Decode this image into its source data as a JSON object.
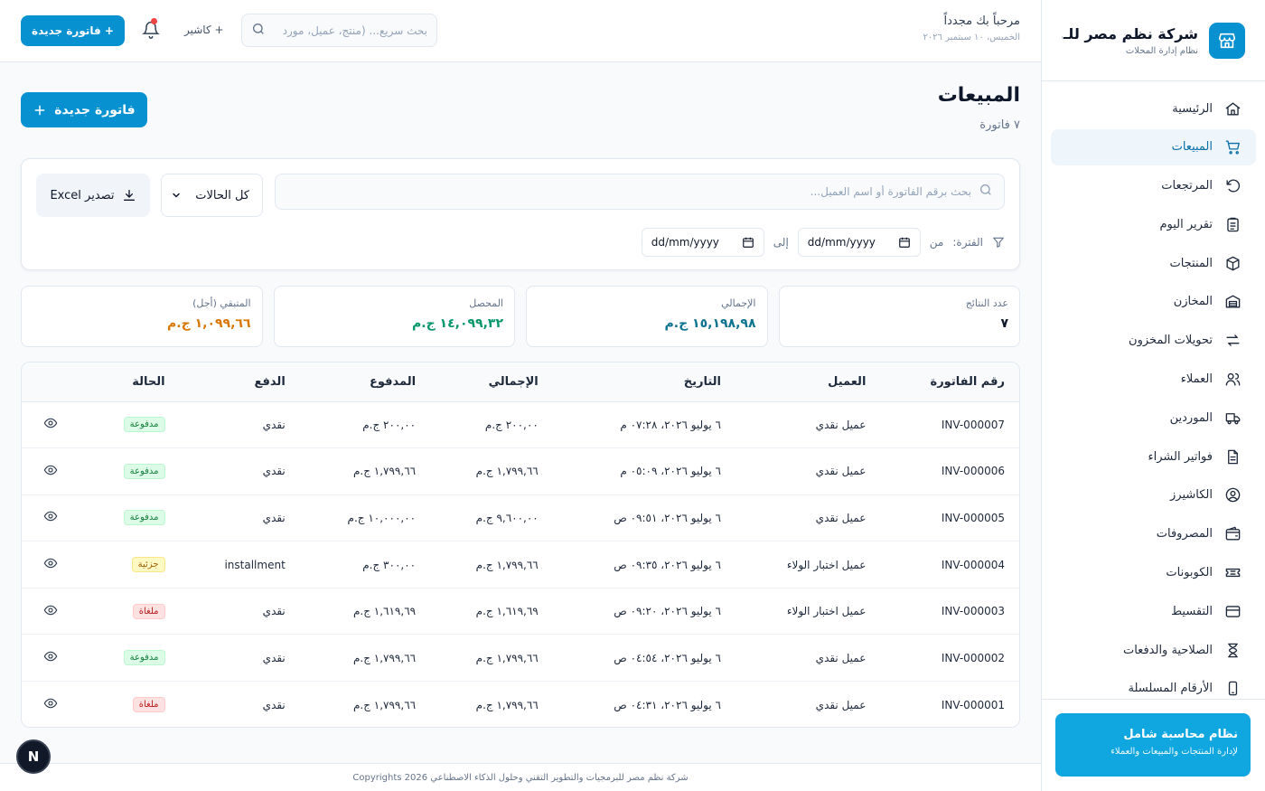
{
  "brand": {
    "name": "شركة نظم مصر للـ...",
    "subtitle": "نظام إدارة المحلات"
  },
  "sidebar": {
    "items": [
      {
        "label": "الرئيسية",
        "icon": "home-icon",
        "active": false
      },
      {
        "label": "المبيعات",
        "icon": "cart-icon",
        "active": true
      },
      {
        "label": "المرتجعات",
        "icon": "undo-icon",
        "active": false
      },
      {
        "label": "تقرير اليوم",
        "icon": "clipboard-icon",
        "active": false
      },
      {
        "label": "المنتجات",
        "icon": "box-icon",
        "active": false
      },
      {
        "label": "المخازن",
        "icon": "warehouse-icon",
        "active": false
      },
      {
        "label": "تحويلات المخزون",
        "icon": "transfer-icon",
        "active": false
      },
      {
        "label": "العملاء",
        "icon": "users-icon",
        "active": false
      },
      {
        "label": "الموردين",
        "icon": "truck-icon",
        "active": false
      },
      {
        "label": "فواتير الشراء",
        "icon": "file-icon",
        "active": false
      },
      {
        "label": "الكاشيرز",
        "icon": "user-circle-icon",
        "active": false
      },
      {
        "label": "المصروفات",
        "icon": "wallet-icon",
        "active": false
      },
      {
        "label": "الكوبونات",
        "icon": "ticket-icon",
        "active": false
      },
      {
        "label": "التقسيط",
        "icon": "credit-card-icon",
        "active": false
      },
      {
        "label": "الصلاحية والدفعات",
        "icon": "hourglass-icon",
        "active": false
      },
      {
        "label": "الأرقام المسلسلة",
        "icon": "phone-icon",
        "active": false
      }
    ],
    "promo": {
      "title": "نظام محاسبة شامل",
      "subtitle": "لإدارة المنتجات والمبيعات والعملاء"
    }
  },
  "header": {
    "welcome": "مرحباً بك مجدداً",
    "date": "الخميس، ١٠ سبتمبر ٢٠٢٦",
    "search_placeholder": "بحث سريع... (منتج، عميل، مورد",
    "cashier_label": "+ كاشير",
    "new_invoice_label": "+ فاتورة جديدة"
  },
  "page": {
    "title": "المبيعات",
    "subtitle": "٧ فاتورة",
    "new_invoice_label": "فاتورة جديدة"
  },
  "filters": {
    "search_placeholder": "بحث برقم الفاتورة أو اسم العميل...",
    "status_value": "كل الحالات",
    "export_label": "تصدير Excel",
    "period_label": "الفترة:",
    "from_label": "من",
    "to_label": "إلى",
    "from_value": "dd/mm/yyyy",
    "to_value": "dd/mm/yyyy"
  },
  "stats": [
    {
      "label": "عدد النتائج",
      "value": "٧",
      "color": "#0f172a"
    },
    {
      "label": "الإجمالي",
      "value": "١٥,١٩٨,٩٨ ج.م",
      "color": "#0e7490"
    },
    {
      "label": "المحصل",
      "value": "١٤,٠٩٩,٣٢ ج.م",
      "color": "#059669"
    },
    {
      "label": "المتبقي (أجل)",
      "value": "١,٠٩٩,٦٦ ج.م",
      "color": "#d97706"
    }
  ],
  "table": {
    "columns": [
      "رقم الفاتورة",
      "العميل",
      "التاريخ",
      "الإجمالي",
      "المدفوع",
      "الدفع",
      "الحالة"
    ],
    "rows": [
      {
        "invoice": "INV-000007",
        "customer": "عميل نقدي",
        "date": "٦ يوليو ٢٠٢٦، ٠٧:٢٨ م",
        "total": "٢٠٠,٠٠ ج.م",
        "paid": "٢٠٠,٠٠ ج.م",
        "payment": "نقدي",
        "status": "مدفوعة",
        "status_type": "paid"
      },
      {
        "invoice": "INV-000006",
        "customer": "عميل نقدي",
        "date": "٦ يوليو ٢٠٢٦، ٠٥:٠٩ م",
        "total": "١,٧٩٩,٦٦ ج.م",
        "paid": "١,٧٩٩,٦٦ ج.م",
        "payment": "نقدي",
        "status": "مدفوعة",
        "status_type": "paid"
      },
      {
        "invoice": "INV-000005",
        "customer": "عميل نقدي",
        "date": "٦ يوليو ٢٠٢٦، ٠٩:٥١ ص",
        "total": "٩,٦٠٠,٠٠ ج.م",
        "paid": "١٠,٠٠٠,٠٠ ج.م",
        "payment": "نقدي",
        "status": "مدفوعة",
        "status_type": "paid"
      },
      {
        "invoice": "INV-000004",
        "customer": "عميل اختبار الولاء",
        "date": "٦ يوليو ٢٠٢٦، ٠٩:٣٥ ص",
        "total": "١,٧٩٩,٦٦ ج.م",
        "paid": "٣٠٠,٠٠ ج.م",
        "payment": "installment",
        "status": "جزئية",
        "status_type": "partial"
      },
      {
        "invoice": "INV-000003",
        "customer": "عميل اختبار الولاء",
        "date": "٦ يوليو ٢٠٢٦، ٠٩:٢٠ ص",
        "total": "١,٦١٩,٦٩ ج.م",
        "paid": "١,٦١٩,٦٩ ج.م",
        "payment": "نقدي",
        "status": "ملغاة",
        "status_type": "cancelled"
      },
      {
        "invoice": "INV-000002",
        "customer": "عميل نقدي",
        "date": "٦ يوليو ٢٠٢٦، ٠٤:٥٤ ص",
        "total": "١,٧٩٩,٦٦ ج.م",
        "paid": "١,٧٩٩,٦٦ ج.م",
        "payment": "نقدي",
        "status": "مدفوعة",
        "status_type": "paid"
      },
      {
        "invoice": "INV-000001",
        "customer": "عميل نقدي",
        "date": "٦ يوليو ٢٠٢٦، ٠٤:٣١ ص",
        "total": "١,٧٩٩,٦٦ ج.م",
        "paid": "١,٧٩٩,٦٦ ج.م",
        "payment": "نقدي",
        "status": "ملغاة",
        "status_type": "cancelled"
      }
    ]
  },
  "status_colors": {
    "paid": {
      "bg": "#dcfce7",
      "fg": "#15803d",
      "border": "#bbf7d0"
    },
    "partial": {
      "bg": "#fef9c3",
      "fg": "#a16207",
      "border": "#fde68a"
    },
    "cancelled": {
      "bg": "#fee2e2",
      "fg": "#b91c1c",
      "border": "#fecaca"
    }
  },
  "footer": {
    "text": "شركة نظم مصر للبرمجيات والتطوير التقني وحلول الذكاء الاصطناعي Copyrights 2026"
  },
  "dev_badge": "N"
}
